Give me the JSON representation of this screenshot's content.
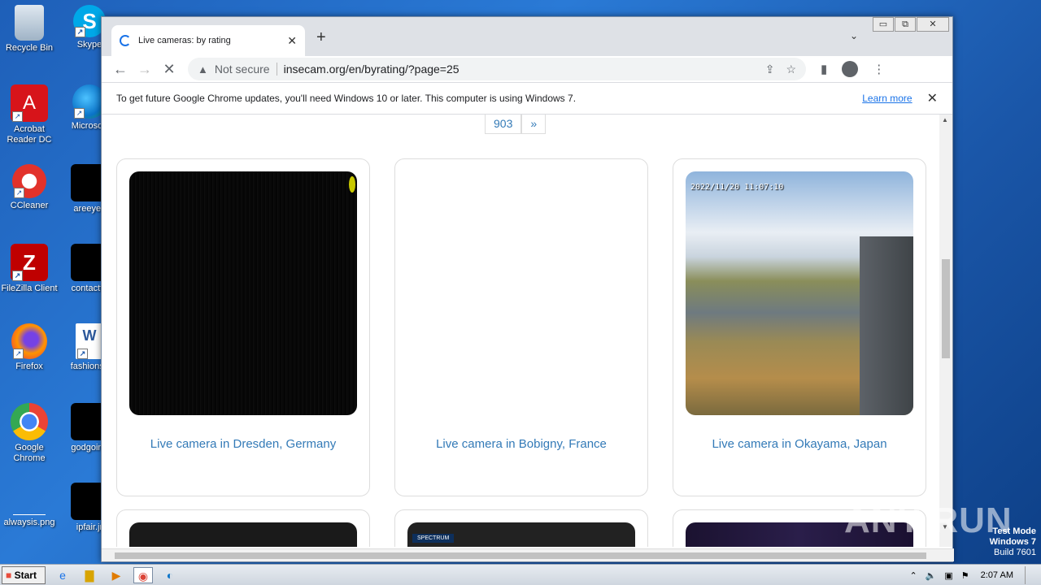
{
  "desktop": {
    "icons": [
      {
        "label": "Recycle Bin",
        "icon": "recycle-bin-icon"
      },
      {
        "label": "Skype",
        "icon": "skype-icon"
      },
      {
        "label": "Acrobat Reader DC",
        "icon": "acrobat-icon"
      },
      {
        "label": "Microsoft",
        "icon": "edge-icon"
      },
      {
        "label": "CCleaner",
        "icon": "ccleaner-icon"
      },
      {
        "label": "areeyes",
        "icon": "file-icon"
      },
      {
        "label": "FileZilla Client",
        "icon": "filezilla-icon"
      },
      {
        "label": "contactfri",
        "icon": "file-icon"
      },
      {
        "label": "Firefox",
        "icon": "firefox-icon"
      },
      {
        "label": "fashionsy",
        "icon": "word-doc-icon"
      },
      {
        "label": "Google Chrome",
        "icon": "chrome-icon"
      },
      {
        "label": "godgoing",
        "icon": "file-icon"
      },
      {
        "label": "alwaysis.png",
        "icon": "image-icon"
      },
      {
        "label": "ipfair.jr",
        "icon": "file-icon"
      }
    ]
  },
  "browser": {
    "tab": {
      "title": "Live cameras: by rating",
      "close": "✕"
    },
    "new_tab": "+",
    "window_controls": {
      "minimize": "▭",
      "restore": "⧉",
      "close": "✕"
    },
    "omnibox": {
      "security": "Not secure",
      "url": "insecam.org/en/byrating/?page=25"
    },
    "infobar": {
      "message": "To get future Google Chrome updates, you'll need Windows 10 or later. This computer is using Windows 7.",
      "link": "Learn more",
      "close": "✕"
    }
  },
  "page": {
    "pager": [
      "903",
      "»"
    ],
    "cameras": [
      {
        "caption": "Live camera in Dresden, Germany",
        "thumb": "dark"
      },
      {
        "caption": "Live camera in Bobigny, France",
        "thumb": "blank"
      },
      {
        "caption": "Live camera in Okayama, Japan",
        "thumb": "landscape",
        "timestamp": "2022/11/20 11:07:10"
      }
    ],
    "next_row_label": "SPECTRUM"
  },
  "taskbar": {
    "start": "Start",
    "clock": "2:07 AM"
  },
  "watermark": {
    "brand": "ANY RUN",
    "line1": "Test Mode",
    "line2": "Windows 7",
    "line3": "Build 7601"
  }
}
